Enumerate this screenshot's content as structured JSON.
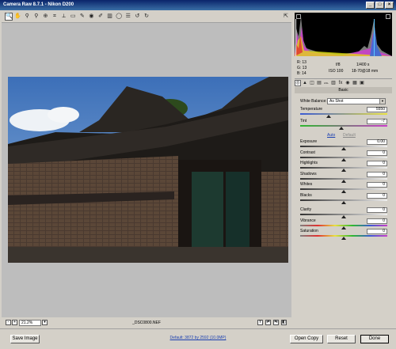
{
  "window": {
    "title": "Camera Raw 8.7.1  -  Nikon D200",
    "controls": [
      "_",
      "□",
      "×"
    ]
  },
  "toolbar": {
    "tools": [
      {
        "name": "zoom-tool-icon",
        "glyph": "🔍"
      },
      {
        "name": "hand-tool-icon",
        "glyph": "✋"
      },
      {
        "name": "white-balance-tool-icon",
        "glyph": "⚲"
      },
      {
        "name": "color-sampler-tool-icon",
        "glyph": "⚲"
      },
      {
        "name": "targeted-adjustment-tool-icon",
        "glyph": "⊕"
      },
      {
        "name": "crop-tool-icon",
        "glyph": "⌗"
      },
      {
        "name": "straighten-tool-icon",
        "glyph": "⟂"
      },
      {
        "name": "transform-tool-icon",
        "glyph": "▭"
      },
      {
        "name": "spot-removal-tool-icon",
        "glyph": "✎"
      },
      {
        "name": "red-eye-tool-icon",
        "glyph": "◉"
      },
      {
        "name": "adjustment-brush-icon",
        "glyph": "✐"
      },
      {
        "name": "graduated-filter-icon",
        "glyph": "▥"
      },
      {
        "name": "radial-filter-icon",
        "glyph": "◯"
      },
      {
        "name": "preferences-icon",
        "glyph": "☰"
      },
      {
        "name": "rotate-ccw-icon",
        "glyph": "↺"
      },
      {
        "name": "rotate-cw-icon",
        "glyph": "↻"
      }
    ],
    "fullscreen_glyph": "⇱"
  },
  "statusbar": {
    "zoom": "21.2%",
    "minus": "-",
    "plus": "+",
    "filename": "_DSC0800.NEF",
    "y_label": "Y"
  },
  "info": {
    "r_label": "R:",
    "r_value": "13",
    "g_label": "G:",
    "g_value": "13",
    "b_label": "B:",
    "b_value": "14",
    "aperture": "f/8",
    "shutter": "1/400 s",
    "iso": "ISO 100",
    "lens": "18-70@18 mm"
  },
  "panel": {
    "tabs": [
      "◎",
      "▲",
      "◫",
      "▤",
      "HSL",
      "▥",
      "fx",
      "◉",
      "▦",
      "▣"
    ],
    "section_title": "Basic",
    "white_balance_label": "White Balance:",
    "white_balance_value": "As Shot",
    "temperature_label": "Temperature",
    "temperature_value": "5550",
    "temperature_pos": 0.33,
    "tint_label": "Tint",
    "tint_value": "-7",
    "tint_pos": 0.47,
    "auto_label": "Auto",
    "default_label": "Default",
    "sliders": [
      {
        "label": "Exposure",
        "value": "0.00",
        "pos": 0.5
      },
      {
        "label": "Contrast",
        "value": "0",
        "pos": 0.5
      },
      {
        "label": "Highlights",
        "value": "0",
        "pos": 0.5
      },
      {
        "label": "Shadows",
        "value": "0",
        "pos": 0.5
      },
      {
        "label": "Whites",
        "value": "0",
        "pos": 0.5
      },
      {
        "label": "Blacks",
        "value": "0",
        "pos": 0.5
      }
    ],
    "presence": [
      {
        "label": "Clarity",
        "value": "0",
        "pos": 0.5
      },
      {
        "label": "Vibrance",
        "value": "0",
        "pos": 0.5
      },
      {
        "label": "Saturation",
        "value": "0",
        "pos": 0.5
      }
    ]
  },
  "bottom": {
    "save_label": "Save Image",
    "workflow_link": "Default: 3872 by 2592 (10.0MP)",
    "open_label": "Open Copy",
    "reset_label": "Reset",
    "done_label": "Done"
  }
}
